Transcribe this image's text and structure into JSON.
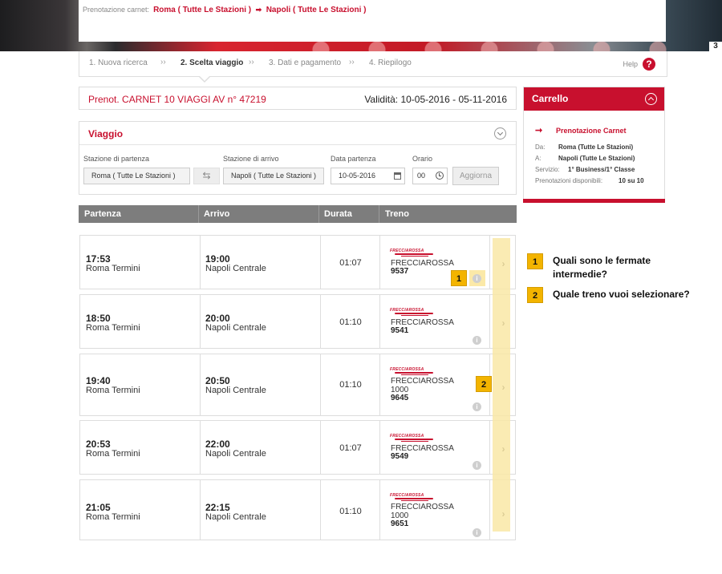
{
  "route": {
    "label": "Prenotazione carnet:",
    "from": "Roma ( Tutte Le Stazioni )",
    "to": "Napoli ( Tutte Le Stazioni )"
  },
  "banner": {
    "train_number": "3"
  },
  "steps": [
    {
      "label": "1. Nuova ricerca"
    },
    {
      "label": "2. Scelta viaggio"
    },
    {
      "label": "3. Dati e pagamento"
    },
    {
      "label": "4. Riepilogo"
    }
  ],
  "step_sep": "»›",
  "help": {
    "label": "Help",
    "icon": "?"
  },
  "prenot": {
    "title": "Prenot. CARNET 10 VIAGGI AV n° 47219",
    "validity": "Validità: 10-05-2016 - 05-11-2016"
  },
  "viaggio": {
    "title": "Viaggio",
    "departure_label": "Stazione di partenza",
    "departure_value": "Roma ( Tutte Le Stazioni )",
    "arrival_label": "Stazione di arrivo",
    "arrival_value": "Napoli ( Tutte Le Stazioni )",
    "date_label": "Data partenza",
    "date_value": "10-05-2016",
    "time_label": "Orario",
    "time_value": "00",
    "update_button": "Aggiorna",
    "swap_icon": "⇆"
  },
  "table_headers": [
    "Partenza",
    "Arrivo",
    "Durata",
    "Treno"
  ],
  "logo_text": "FRECCIAROSSA",
  "trains": [
    {
      "dep_time": "17:53",
      "dep_station": "Roma Termini",
      "arr_time": "19:00",
      "arr_station": "Napoli Centrale",
      "duration": "01:07",
      "name": "FRECCIAROSSA",
      "name2": "",
      "number": "9537"
    },
    {
      "dep_time": "18:50",
      "dep_station": "Roma Termini",
      "arr_time": "20:00",
      "arr_station": "Napoli Centrale",
      "duration": "01:10",
      "name": "FRECCIAROSSA",
      "name2": "",
      "number": "9541"
    },
    {
      "dep_time": "19:40",
      "dep_station": "Roma Termini",
      "arr_time": "20:50",
      "arr_station": "Napoli Centrale",
      "duration": "01:10",
      "name": "FRECCIAROSSA",
      "name2": "1000",
      "number": "9645"
    },
    {
      "dep_time": "20:53",
      "dep_station": "Roma Termini",
      "arr_time": "22:00",
      "arr_station": "Napoli Centrale",
      "duration": "01:07",
      "name": "FRECCIAROSSA",
      "name2": "",
      "number": "9549"
    },
    {
      "dep_time": "21:05",
      "dep_station": "Roma Termini",
      "arr_time": "22:15",
      "arr_station": "Napoli Centrale",
      "duration": "01:10",
      "name": "FRECCIAROSSA",
      "name2": "1000",
      "number": "9651"
    }
  ],
  "icons": {
    "info": "i",
    "chevron": "›"
  },
  "cart": {
    "title": "Carrello",
    "item": "Prenotazione Carnet",
    "arrow": "➞",
    "from_key": "Da:",
    "from_value": "Roma (Tutte Le Stazioni)",
    "to_key": "A:",
    "to_value": "Napoli (Tutte Le Stazioni)",
    "service_key": "Servizio:",
    "service_value": "1° Business/1° Classe",
    "avail_key": "Prenotazioni disponibili:",
    "avail_value": "10 su 10"
  },
  "annotations": [
    {
      "badge": "1",
      "text": "Quali sono le fermate intermedie?"
    },
    {
      "badge": "2",
      "text": "Quale treno vuoi selezionare?"
    }
  ],
  "colors": {
    "brand_red": "#c8102e",
    "highlight_yellow": "#f9e7a6",
    "badge_yellow": "#f3b400"
  }
}
